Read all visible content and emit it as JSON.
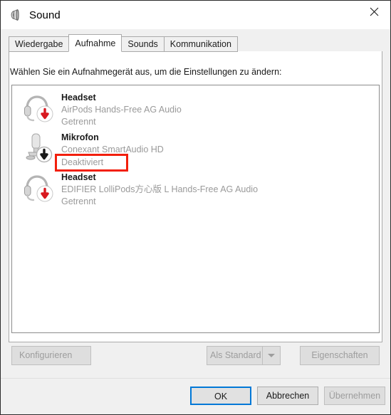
{
  "window": {
    "title": "Sound",
    "icon": "speaker-icon",
    "close_label": "✕"
  },
  "tabs": [
    {
      "label": "Wiedergabe",
      "active": false
    },
    {
      "label": "Aufnahme",
      "active": true
    },
    {
      "label": "Sounds",
      "active": false
    },
    {
      "label": "Kommunikation",
      "active": false
    }
  ],
  "panel": {
    "prompt": "Wählen Sie ein Aufnahmegerät aus, um die Einstellungen zu ändern:"
  },
  "devices": [
    {
      "name": "Headset",
      "description": "AirPods Hands-Free AG Audio",
      "status": "Getrennt",
      "icon": "headset-icon",
      "badge": "red-down-arrow-badge",
      "highlighted": false
    },
    {
      "name": "Mikrofon",
      "description": "Conexant SmartAudio HD",
      "status": "Deaktiviert",
      "icon": "microphone-icon",
      "badge": "grey-down-arrow-badge",
      "highlighted": true
    },
    {
      "name": "Headset",
      "description": "EDIFIER LolliPods方心版 L Hands-Free AG Audio",
      "status": "Getrennt",
      "icon": "headset-icon",
      "badge": "red-down-arrow-badge",
      "highlighted": false
    }
  ],
  "mid_buttons": {
    "configure": "Konfigurieren",
    "set_default": "Als Standard",
    "set_default_arrow": "chevron-down-icon",
    "properties": "Eigenschaften"
  },
  "footer_buttons": {
    "ok": "OK",
    "cancel": "Abbrechen",
    "apply": "Übernehmen"
  },
  "colors": {
    "highlight_red": "#f21f0c",
    "focus_blue": "#0078d7",
    "disabled_text": "#9d9d9d",
    "secondary_text": "#9a9a9a"
  }
}
